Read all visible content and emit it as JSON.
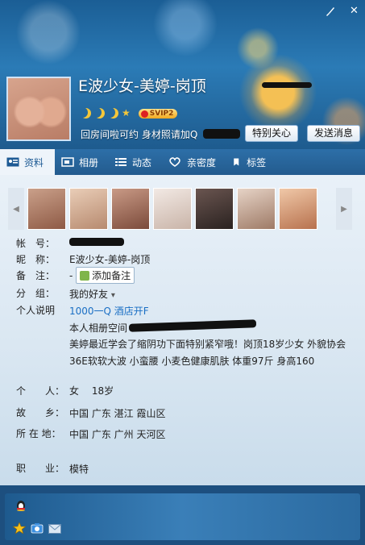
{
  "header": {
    "nickname": "E波少女-美婷-岗顶",
    "signature": "回房间啦可约 身材照请加Q",
    "vip_label": "SVIP2",
    "follow_button": "特别关心",
    "message_button": "发送消息",
    "controls": {
      "skin_icon": "brush-icon",
      "close_icon": "close-icon",
      "close_label": "✕"
    }
  },
  "tabs": [
    {
      "label": "资料",
      "icon": "profile-card-icon",
      "active": true
    },
    {
      "label": "相册",
      "icon": "album-icon"
    },
    {
      "label": "动态",
      "icon": "feed-list-icon"
    },
    {
      "label": "亲密度",
      "icon": "heart-icon"
    },
    {
      "label": "标签",
      "icon": "bookmark-icon"
    }
  ],
  "profile": {
    "account_label": "帐　号：",
    "nickname_label": "昵　称：",
    "nickname_value": "E波少女-美婷-岗顶",
    "remark_label": "备　注：",
    "remark_value": "-",
    "remark_button": "添加备注",
    "group_label": "分　组：",
    "group_value": "我的好友",
    "group_arrow": "▾",
    "intro_label": "个人说明",
    "intro_lines": [
      "1000一Q 酒店开F",
      "本人相册空间",
      "美婷最近学会了缩阴功下面特别紧窄哦！岗顶18岁少女 外貌协会",
      "36E软软大波 小蛮腰 小麦色健康肌肤 体重97斤 身高160"
    ],
    "personal_label": "个　　人：",
    "gender": "女",
    "age": "18岁",
    "hometown_label": "故　　乡：",
    "hometown_value": "中国 广东 湛江 霞山区",
    "location_label": "所 在 地：",
    "location_value": "中国 广东 广州 天河区",
    "job_label": "职　　业：",
    "job_value": "模特"
  },
  "photostrip": {
    "left_arrow": "◀",
    "right_arrow": "▶"
  },
  "colors": {
    "header": "#2b7bb6",
    "tab_bar": "#2d6fa8",
    "accent_gold": "#f4c73a"
  }
}
